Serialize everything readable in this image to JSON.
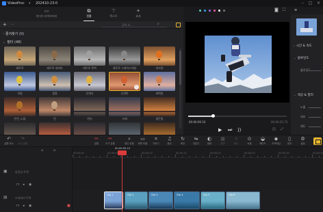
{
  "app": {
    "name": "VideoProc",
    "project": "202410-23-0"
  },
  "media_tabs": [
    {
      "label": "미디어 라이브러리",
      "icon": "folder-icon"
    },
    {
      "label": "전환",
      "icon": "transition-icon"
    },
    {
      "label": "텍스트",
      "icon": "text-icon"
    },
    {
      "label": "효과",
      "icon": "sparkle-icon"
    }
  ],
  "media_toolbar": {
    "add": "+",
    "more": "···",
    "search_placeholder": "검색 효..."
  },
  "sections": {
    "favorites": "즐겨찾기 (0)",
    "filters": "필터 (48)"
  },
  "filters": [
    "레트로",
    "레트로 세피아",
    "레트로 흑백",
    "레트로 그레이스케일",
    "여가현",
    "모험",
    "몽환",
    "안개속",
    "선셋톤",
    "새벽빛",
    "은은_노을",
    "빈",
    "빈티",
    "크레",
    "골든빛",
    "",
    "",
    "",
    "",
    ""
  ],
  "preview": {
    "time_current": "00:00:09.10",
    "time_total": "00:00:25.73",
    "progress": 0.26,
    "controls": [
      "play-icon",
      "skip-back-icon",
      "skip-forward-icon"
    ]
  },
  "inspector": {
    "sections": [
      "시간 & 속도",
      "블루밍도",
      "색상 & 필터"
    ],
    "labels": [
      "블루밍도",
      "노출",
      "대조",
      "채도"
    ]
  },
  "timeline_tools": [
    "실행 취소",
    "다시 실행",
    "분할",
    "도구 분할",
    "줌인 맞춤",
    "화면 비율",
    "자르기",
    "음성",
    "회전",
    "뒤집기",
    "음량",
    "장면",
    "애니",
    "녹음",
    "페이드",
    "키프레임",
    "정지",
    "설정"
  ],
  "timeline": {
    "playhead_time": "00:00:09.10",
    "ruler_labels": [
      "00:00:00",
      "00:00:05",
      "00:00:10",
      "00:00:15",
      "00:00:20",
      "00:00:25",
      "00:00:30",
      "00:00:35"
    ],
    "tracks": [
      "동영상 트랙",
      "오버레이 트랙"
    ],
    "clips": [
      "Clip 1",
      "Clip 2",
      "Clip 3",
      "Clip 4",
      "Clip 5",
      "Clip 6"
    ]
  },
  "colors": {
    "accent": "#e8b730",
    "playhead": "#d83c3c",
    "panel": "#232326"
  }
}
